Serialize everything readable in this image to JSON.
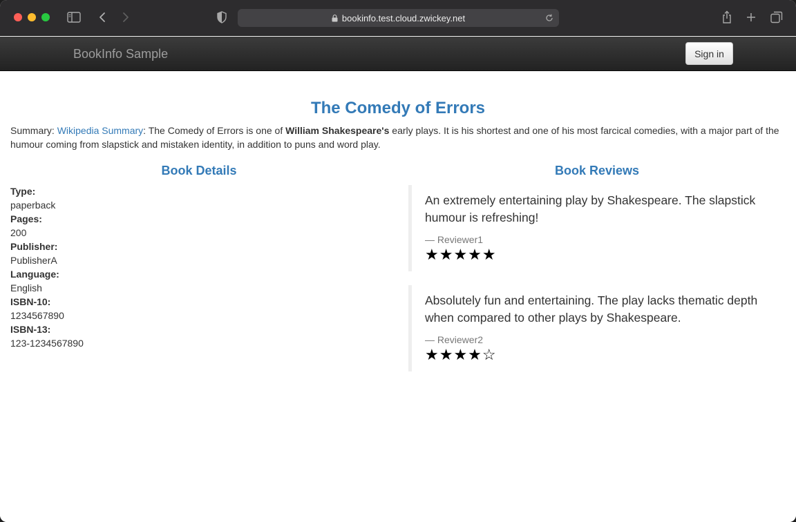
{
  "browser": {
    "url": "bookinfo.test.cloud.zwickey.net"
  },
  "navbar": {
    "brand": "BookInfo Sample",
    "signin_label": "Sign in"
  },
  "book": {
    "title": "The Comedy of Errors",
    "summary_prefix": "Summary: ",
    "summary_link": "Wikipedia Summary",
    "summary_mid": ": The Comedy of Errors is one of ",
    "summary_bold": "William Shakespeare's",
    "summary_rest": " early plays. It is his shortest and one of his most farcical comedies, with a major part of the humour coming from slapstick and mistaken identity, in addition to puns and word play."
  },
  "details": {
    "heading": "Book Details",
    "type_label": "Type:",
    "type_value": "paperback",
    "pages_label": "Pages:",
    "pages_value": "200",
    "publisher_label": "Publisher:",
    "publisher_value": "PublisherA",
    "language_label": "Language:",
    "language_value": "English",
    "isbn10_label": "ISBN-10:",
    "isbn10_value": "1234567890",
    "isbn13_label": "ISBN-13:",
    "isbn13_value": "123-1234567890"
  },
  "reviews": {
    "heading": "Book Reviews",
    "items": [
      {
        "text": "An extremely entertaining play by Shakespeare. The slapstick humour is refreshing!",
        "author": "— Reviewer1",
        "rating": 5,
        "stars": "★★★★★"
      },
      {
        "text": "Absolutely fun and entertaining. The play lacks thematic depth when compared to other plays by Shakespeare.",
        "author": "— Reviewer2",
        "rating": 4,
        "stars": "★★★★☆"
      }
    ]
  }
}
